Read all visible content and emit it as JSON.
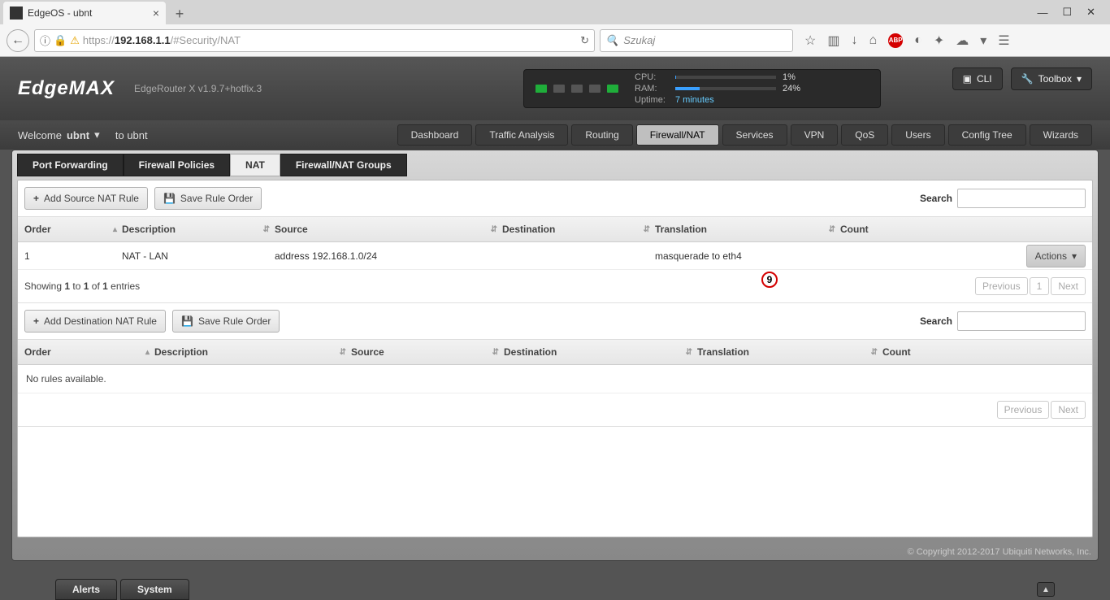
{
  "browser": {
    "tab_title": "EdgeOS - ubnt",
    "url_host": "192.168.1.1",
    "url_path": "/#Security/NAT",
    "url_prefix": "https://",
    "search_placeholder": "Szukaj"
  },
  "header": {
    "logo": "EdgeMAX",
    "model": "EdgeRouter X v1.9.7+hotfix.3",
    "cli_label": "CLI",
    "toolbox_label": "Toolbox",
    "stats": {
      "cpu_label": "CPU:",
      "cpu_percent": 1,
      "cpu_text": "1%",
      "ram_label": "RAM:",
      "ram_percent": 24,
      "ram_text": "24%",
      "uptime_label": "Uptime:",
      "uptime": "7 minutes"
    },
    "ports": [
      true,
      false,
      false,
      false,
      true
    ]
  },
  "welcome": {
    "prefix": "Welcome",
    "user": "ubnt",
    "to": "to ubnt"
  },
  "main_tabs": [
    "Dashboard",
    "Traffic Analysis",
    "Routing",
    "Firewall/NAT",
    "Services",
    "VPN",
    "QoS",
    "Users",
    "Config Tree",
    "Wizards"
  ],
  "main_active": "Firewall/NAT",
  "inner_tabs": [
    "Port Forwarding",
    "Firewall Policies",
    "NAT",
    "Firewall/NAT Groups"
  ],
  "inner_active": "NAT",
  "source_nat": {
    "add_btn": "Add Source NAT Rule",
    "save_btn": "Save Rule Order",
    "search_label": "Search",
    "cols": [
      "Order",
      "Description",
      "Source",
      "Destination",
      "Translation",
      "Count"
    ],
    "rows": [
      {
        "order": "1",
        "description": "NAT - LAN",
        "source": "address 192.168.1.0/24",
        "destination": "",
        "translation": "masquerade to eth4",
        "count": ""
      }
    ],
    "actions_label": "Actions",
    "showing": "Showing 1 to 1 of 1 entries",
    "prev": "Previous",
    "page": "1",
    "next": "Next",
    "annotation": "9"
  },
  "dest_nat": {
    "add_btn": "Add Destination NAT Rule",
    "save_btn": "Save Rule Order",
    "search_label": "Search",
    "cols": [
      "Order",
      "Description",
      "Source",
      "Destination",
      "Translation",
      "Count"
    ],
    "no_rules": "No rules available.",
    "prev": "Previous",
    "next": "Next"
  },
  "footer": {
    "copyright": "© Copyright 2012-2017 Ubiquiti Networks, Inc."
  },
  "bottom_tabs": [
    "Alerts",
    "System"
  ]
}
